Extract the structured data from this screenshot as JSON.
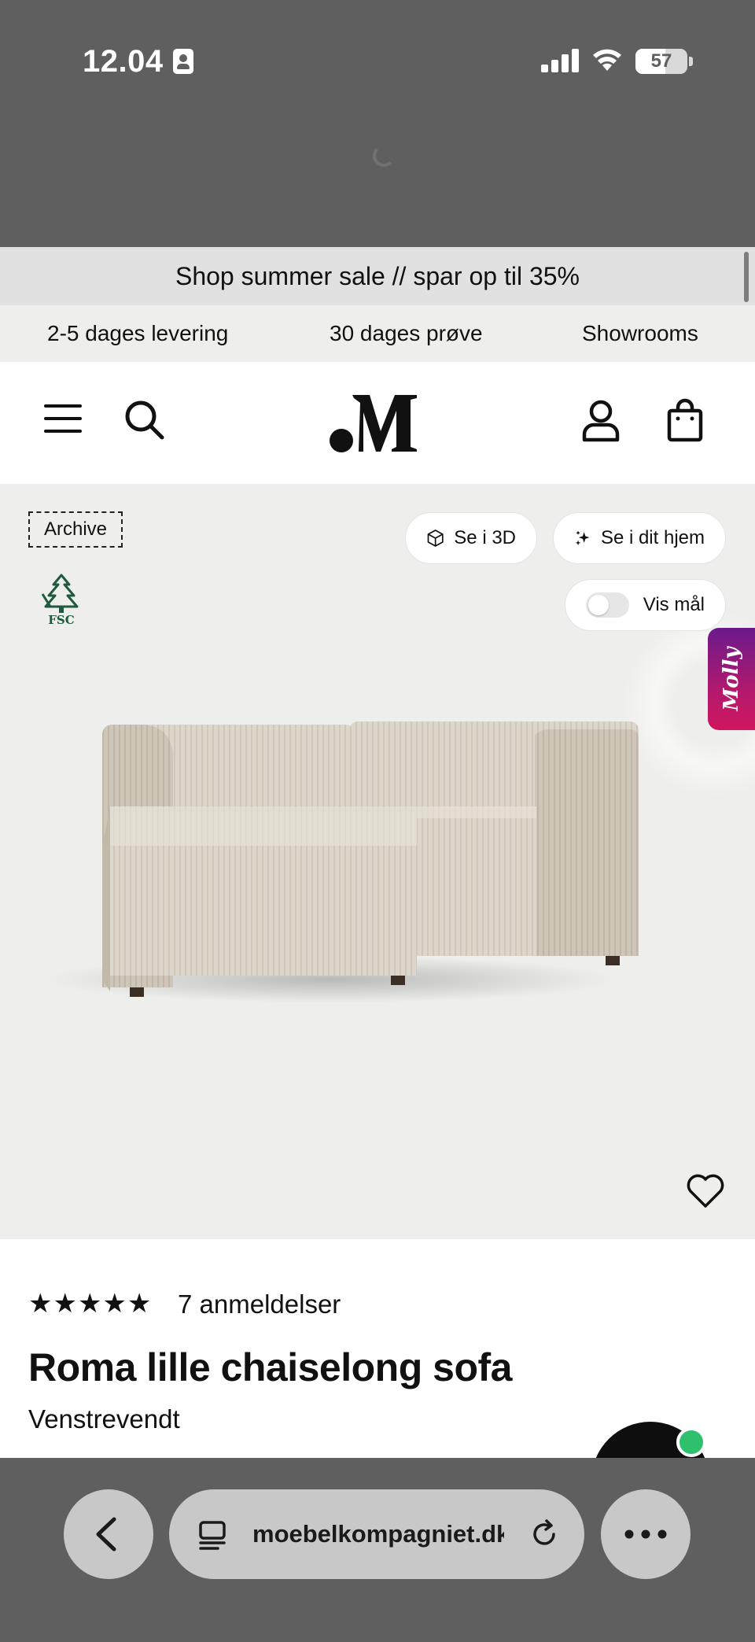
{
  "status_bar": {
    "time": "12.04",
    "battery": "57",
    "battery_level": 0.57
  },
  "promo": {
    "text": "Shop summer sale // spar op til 35%"
  },
  "usp": {
    "delivery": "2-5 dages levering",
    "trial": "30 dages prøve",
    "showrooms": "Showrooms"
  },
  "header": {
    "icons": [
      "menu-icon",
      "search-icon",
      "logo",
      "account-icon",
      "bag-icon"
    ]
  },
  "hero": {
    "archive_label": "Archive",
    "view_3d_label": "Se i 3D",
    "view_home_label": "Se i dit hjem",
    "show_dimensions_label": "Vis mål",
    "molly_label": "Molly"
  },
  "product": {
    "stars": "★★★★★",
    "rating": 5,
    "reviews": "7 anmeldelser",
    "title": "Roma lille chaiselong sofa",
    "variant": "Venstrevendt"
  },
  "browser": {
    "url": "moebelkompagniet.dk"
  },
  "colors": {
    "chrome": "#5f5f5f",
    "promo_bg": "#e1e1e1",
    "usp_bg": "#eeeeea",
    "hero_bg": "#eeeeec",
    "molly_gradient_start": "#6b1a8c",
    "molly_gradient_end": "#d2165e",
    "online_dot": "#2fc06e"
  }
}
